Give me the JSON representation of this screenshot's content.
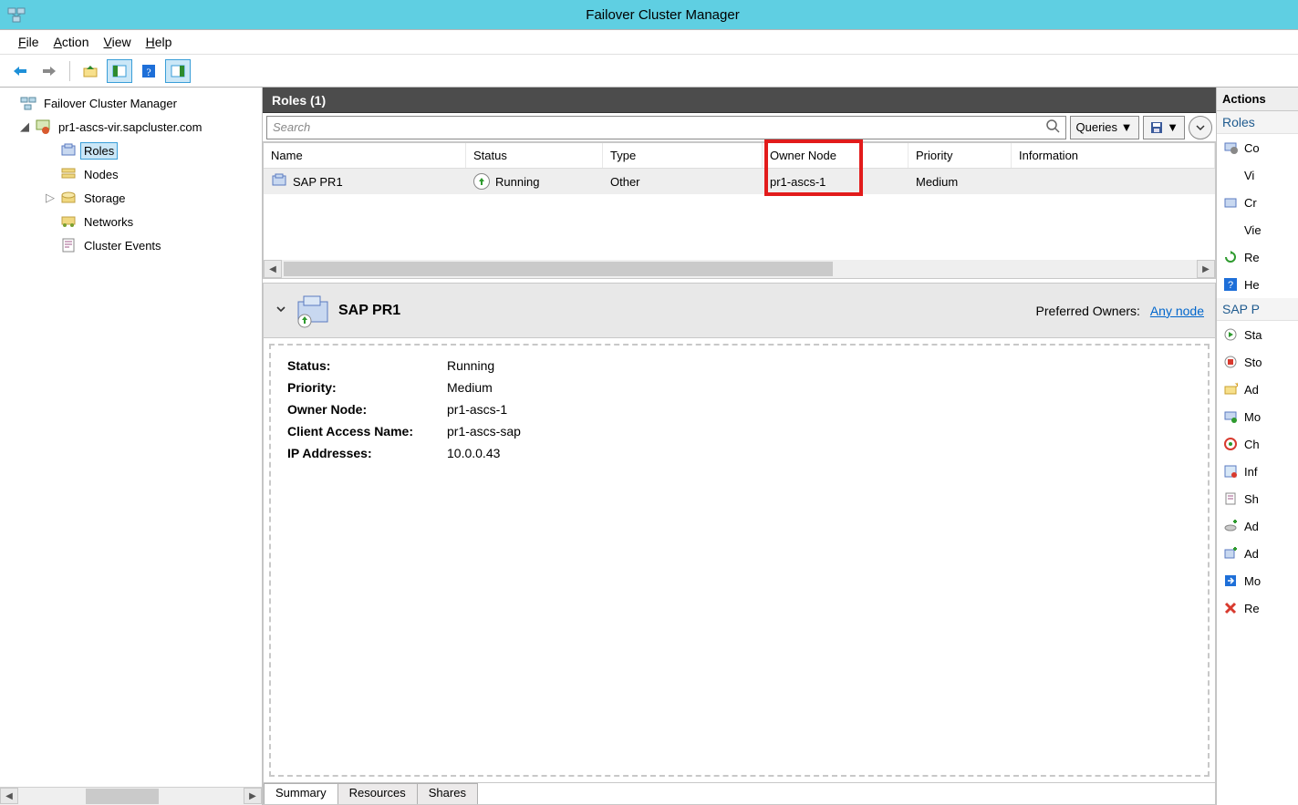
{
  "app": {
    "title": "Failover Cluster Manager"
  },
  "menu": {
    "file": "File",
    "action": "Action",
    "view": "View",
    "help": "Help"
  },
  "tree": {
    "root": "Failover Cluster Manager",
    "cluster": "pr1-ascs-vir.sapcluster.com",
    "nodes": [
      "Roles",
      "Nodes",
      "Storage",
      "Networks",
      "Cluster Events"
    ]
  },
  "roles": {
    "heading": "Roles (1)",
    "searchPlaceholder": "Search",
    "queriesLabel": "Queries",
    "columns": [
      "Name",
      "Status",
      "Type",
      "Owner Node",
      "Priority",
      "Information"
    ],
    "rows": [
      {
        "name": "SAP PR1",
        "status": "Running",
        "type": "Other",
        "owner": "pr1-ascs-1",
        "priority": "Medium",
        "info": ""
      }
    ]
  },
  "details": {
    "title": "SAP PR1",
    "preferredLabel": "Preferred Owners:",
    "preferredLink": "Any node",
    "kv": {
      "statusK": "Status:",
      "statusV": "Running",
      "priorityK": "Priority:",
      "priorityV": "Medium",
      "ownerK": "Owner Node:",
      "ownerV": "pr1-ascs-1",
      "canK": "Client Access Name:",
      "canV": "pr1-ascs-sap",
      "ipK": "IP Addresses:",
      "ipV": "10.0.0.43"
    },
    "tabs": [
      "Summary",
      "Resources",
      "Shares"
    ]
  },
  "actions": {
    "paneTitle": "Actions",
    "group1": "Roles",
    "g1items": [
      "Co",
      "Vi",
      "Cr",
      "Vie",
      "Re",
      "He"
    ],
    "group2": "SAP P",
    "g2items": [
      "Sta",
      "Sto",
      "Ad",
      "Mo",
      "Ch",
      "Inf",
      "Sh",
      "Ad",
      "Ad",
      "Mo",
      "Re"
    ]
  }
}
